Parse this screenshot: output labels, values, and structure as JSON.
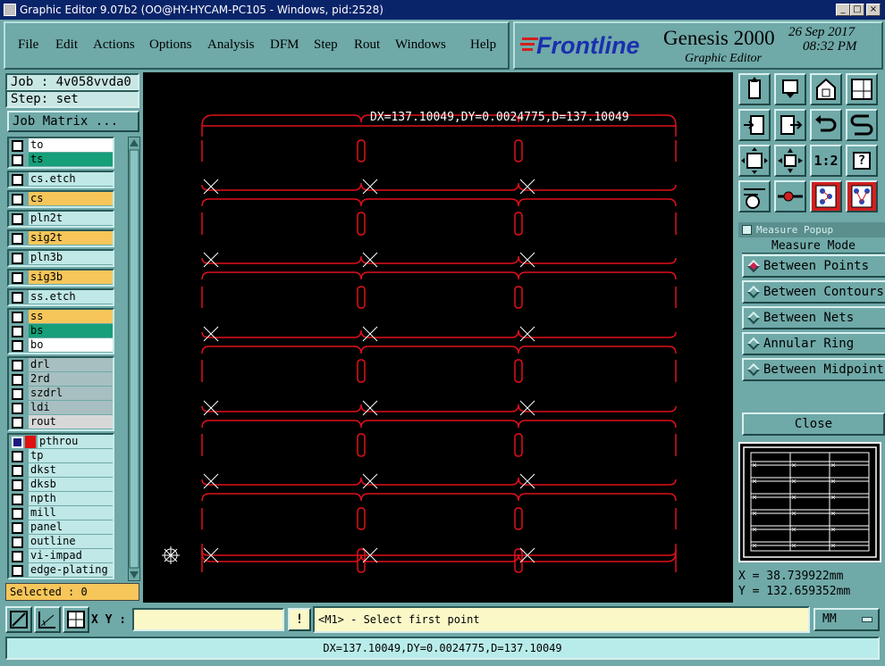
{
  "window": {
    "title": "Graphic Editor 9.07b2 (OO@HY-HYCAM-PC105 - Windows, pid:2528)",
    "minimize_glyph": "_",
    "maximize_glyph": "□",
    "close_glyph": "×"
  },
  "menu": {
    "items": [
      "File",
      "Edit",
      "Actions",
      "Options",
      "Analysis",
      "DFM",
      "Step",
      "Rout",
      "Windows",
      "Help"
    ]
  },
  "brand": {
    "logo": "Frontline",
    "product": "Genesis 2000",
    "subtitle": "Graphic Editor",
    "date": "26 Sep 2017",
    "time": "08:32 PM"
  },
  "job": {
    "job_label": "Job : 4v058vvda0",
    "step_label": "Step: set",
    "matrix_button": "Job Matrix ..."
  },
  "layers": {
    "groups": [
      [
        {
          "name": "to",
          "color": "#ffffff"
        },
        {
          "name": "ts",
          "color": "#169f78"
        }
      ],
      [
        {
          "name": "cs.etch",
          "color": "#bfe8e6"
        }
      ],
      [
        {
          "name": "cs",
          "color": "#f7c65a"
        }
      ],
      [
        {
          "name": "pln2t",
          "color": "#bfe8e6"
        }
      ],
      [
        {
          "name": "sig2t",
          "color": "#f7c65a"
        }
      ],
      [
        {
          "name": "pln3b",
          "color": "#bfe8e6"
        }
      ],
      [
        {
          "name": "sig3b",
          "color": "#f7c65a"
        }
      ],
      [
        {
          "name": "ss.etch",
          "color": "#bfe8e6"
        }
      ],
      [
        {
          "name": "ss",
          "color": "#f7c65a"
        },
        {
          "name": "bs",
          "color": "#169f78"
        },
        {
          "name": "bo",
          "color": "#ffffff"
        }
      ],
      [
        {
          "name": "drl",
          "color": "#a7bfc0"
        },
        {
          "name": "2rd",
          "color": "#a7bfc0"
        },
        {
          "name": "szdrl",
          "color": "#a7bfc0"
        },
        {
          "name": "ldi",
          "color": "#a7bfc0"
        },
        {
          "name": "rout",
          "color": "#d8d8d8"
        }
      ],
      [
        {
          "name": "pthrou",
          "color": "#bfe8e6",
          "active": true
        },
        {
          "name": "tp",
          "color": "#bfe8e6"
        },
        {
          "name": "dkst",
          "color": "#bfe8e6"
        },
        {
          "name": "dksb",
          "color": "#bfe8e6"
        },
        {
          "name": "npth",
          "color": "#bfe8e6"
        },
        {
          "name": "mill",
          "color": "#bfe8e6"
        },
        {
          "name": "panel",
          "color": "#bfe8e6"
        },
        {
          "name": "outline",
          "color": "#bfe8e6"
        },
        {
          "name": "vi-impad",
          "color": "#bfe8e6"
        },
        {
          "name": "edge-plating",
          "color": "#bfe8e6"
        }
      ]
    ],
    "selected_label": "Selected : 0"
  },
  "canvas": {
    "measure_readout": "DX=137.10049,DY=0.0024775,D=137.10049",
    "background": "#000000",
    "outline_color": "#e0101a"
  },
  "tools": [
    "zoom-home-icon",
    "pan-down-icon",
    "home-icon",
    "layout-icon",
    "import-icon",
    "export-icon",
    "undo-icon",
    "snap-icon",
    "fit-all-icon",
    "zoom-center-icon",
    "scale-1-2-icon",
    "help-icon",
    "settings-icon",
    "measure-probe-icon",
    "netlist-icon",
    "netlist-compare-icon"
  ],
  "tool_labels": {
    "scale": "1:2",
    "help": "?"
  },
  "measure_popup": {
    "title": "Measure Popup",
    "mode_label": "Measure Mode",
    "options": [
      "Between Points",
      "Between Contours",
      "Between Nets",
      "Annular Ring",
      "Between Midpoints"
    ],
    "selected_index": 0,
    "close_label": "Close"
  },
  "coords": {
    "x_label": "X = 38.739922mm",
    "y_label": "Y = 132.659352mm"
  },
  "command_bar": {
    "xy_label": "X Y :",
    "xy_value": "",
    "prompt": "<M1> - Select first point",
    "units": "MM",
    "exclaim": "!"
  },
  "status": {
    "text": "DX=137.10049,DY=0.0024775,D=137.10049"
  }
}
